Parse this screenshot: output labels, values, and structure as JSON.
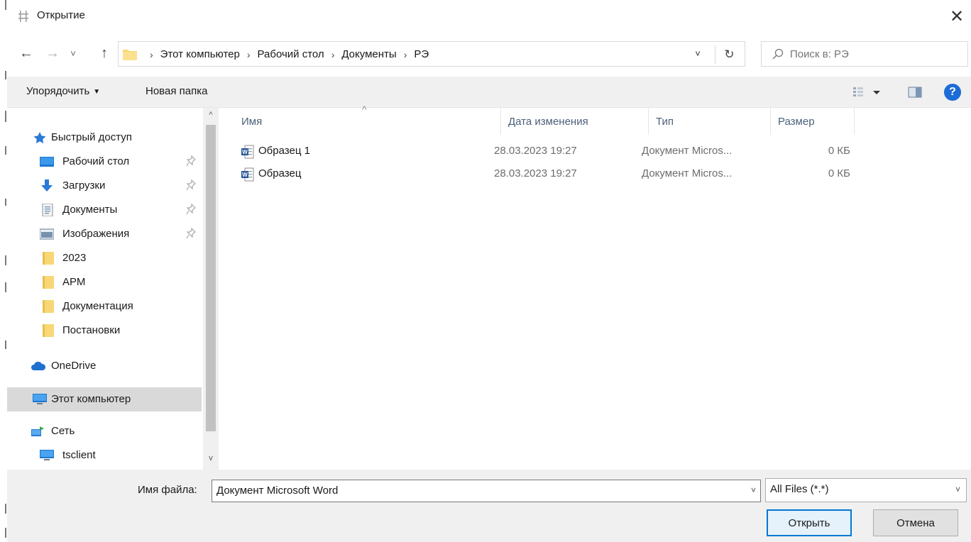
{
  "window": {
    "title": "Открытие",
    "close_glyph": "✕"
  },
  "navigation": {
    "back_glyph": "←",
    "forward_glyph": "→",
    "recent_glyph": "˅",
    "up_glyph": "↑",
    "breadcrumbs": [
      "Этот компьютер",
      "Рабочий стол",
      "Документы",
      "РЭ"
    ],
    "breadcrumb_separator": "›",
    "dropdown_glyph": "˅",
    "refresh_glyph": "↻",
    "search_placeholder": "Поиск в: РЭ"
  },
  "toolbar": {
    "organize_label": "Упорядочить",
    "organize_caret": "▼",
    "new_folder_label": "Новая папка",
    "help_glyph": "?"
  },
  "sidebar": {
    "quick_access": "Быстрый доступ",
    "items": [
      {
        "label": "Рабочий стол",
        "icon": "desktop-icon",
        "pinned": true
      },
      {
        "label": "Загрузки",
        "icon": "download-icon",
        "pinned": true
      },
      {
        "label": "Документы",
        "icon": "documents-icon",
        "pinned": true
      },
      {
        "label": "Изображения",
        "icon": "pictures-icon",
        "pinned": true
      },
      {
        "label": "2023",
        "icon": "folder-icon",
        "pinned": false
      },
      {
        "label": "АРМ",
        "icon": "folder-icon",
        "pinned": false
      },
      {
        "label": "Документация",
        "icon": "folder-icon",
        "pinned": false
      },
      {
        "label": "Постановки",
        "icon": "folder-icon",
        "pinned": false
      }
    ],
    "onedrive": "OneDrive",
    "this_pc": "Этот компьютер",
    "network": "Сеть",
    "tsclient": "tsclient",
    "scroll_up_glyph": "^",
    "scroll_down_glyph": "v"
  },
  "file_list": {
    "sort_glyph": "^",
    "columns": [
      "Имя",
      "Дата изменения",
      "Тип",
      "Размер"
    ],
    "rows": [
      {
        "name": "Образец 1",
        "date": "28.03.2023 19:27",
        "type": "Документ Micros...",
        "size": "0 КБ"
      },
      {
        "name": "Образец",
        "date": "28.03.2023 19:27",
        "type": "Документ Micros...",
        "size": "0 КБ"
      }
    ]
  },
  "bottom": {
    "filename_label": "Имя файла:",
    "filename_value": "Документ Microsoft Word",
    "dropdown_glyph": "˅",
    "file_type": "All Files (*.*)",
    "open_label": "Открыть",
    "cancel_label": "Отмена"
  },
  "colors": {
    "accent": "#0078d7",
    "help": "#1c6cd6",
    "folder": "#f8d775",
    "selected": "#d9d9d9"
  }
}
